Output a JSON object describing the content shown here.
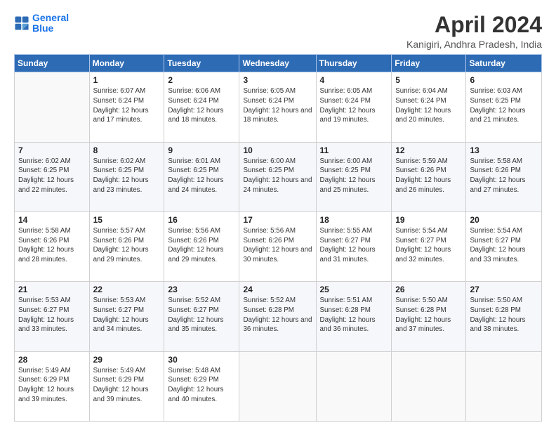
{
  "logo": {
    "line1": "General",
    "line2": "Blue"
  },
  "header": {
    "title": "April 2024",
    "location": "Kanigiri, Andhra Pradesh, India"
  },
  "weekdays": [
    "Sunday",
    "Monday",
    "Tuesday",
    "Wednesday",
    "Thursday",
    "Friday",
    "Saturday"
  ],
  "weeks": [
    [
      {
        "day": "",
        "sunrise": "",
        "sunset": "",
        "daylight": ""
      },
      {
        "day": "1",
        "sunrise": "Sunrise: 6:07 AM",
        "sunset": "Sunset: 6:24 PM",
        "daylight": "Daylight: 12 hours and 17 minutes."
      },
      {
        "day": "2",
        "sunrise": "Sunrise: 6:06 AM",
        "sunset": "Sunset: 6:24 PM",
        "daylight": "Daylight: 12 hours and 18 minutes."
      },
      {
        "day": "3",
        "sunrise": "Sunrise: 6:05 AM",
        "sunset": "Sunset: 6:24 PM",
        "daylight": "Daylight: 12 hours and 18 minutes."
      },
      {
        "day": "4",
        "sunrise": "Sunrise: 6:05 AM",
        "sunset": "Sunset: 6:24 PM",
        "daylight": "Daylight: 12 hours and 19 minutes."
      },
      {
        "day": "5",
        "sunrise": "Sunrise: 6:04 AM",
        "sunset": "Sunset: 6:24 PM",
        "daylight": "Daylight: 12 hours and 20 minutes."
      },
      {
        "day": "6",
        "sunrise": "Sunrise: 6:03 AM",
        "sunset": "Sunset: 6:25 PM",
        "daylight": "Daylight: 12 hours and 21 minutes."
      }
    ],
    [
      {
        "day": "7",
        "sunrise": "Sunrise: 6:02 AM",
        "sunset": "Sunset: 6:25 PM",
        "daylight": "Daylight: 12 hours and 22 minutes."
      },
      {
        "day": "8",
        "sunrise": "Sunrise: 6:02 AM",
        "sunset": "Sunset: 6:25 PM",
        "daylight": "Daylight: 12 hours and 23 minutes."
      },
      {
        "day": "9",
        "sunrise": "Sunrise: 6:01 AM",
        "sunset": "Sunset: 6:25 PM",
        "daylight": "Daylight: 12 hours and 24 minutes."
      },
      {
        "day": "10",
        "sunrise": "Sunrise: 6:00 AM",
        "sunset": "Sunset: 6:25 PM",
        "daylight": "Daylight: 12 hours and 24 minutes."
      },
      {
        "day": "11",
        "sunrise": "Sunrise: 6:00 AM",
        "sunset": "Sunset: 6:25 PM",
        "daylight": "Daylight: 12 hours and 25 minutes."
      },
      {
        "day": "12",
        "sunrise": "Sunrise: 5:59 AM",
        "sunset": "Sunset: 6:26 PM",
        "daylight": "Daylight: 12 hours and 26 minutes."
      },
      {
        "day": "13",
        "sunrise": "Sunrise: 5:58 AM",
        "sunset": "Sunset: 6:26 PM",
        "daylight": "Daylight: 12 hours and 27 minutes."
      }
    ],
    [
      {
        "day": "14",
        "sunrise": "Sunrise: 5:58 AM",
        "sunset": "Sunset: 6:26 PM",
        "daylight": "Daylight: 12 hours and 28 minutes."
      },
      {
        "day": "15",
        "sunrise": "Sunrise: 5:57 AM",
        "sunset": "Sunset: 6:26 PM",
        "daylight": "Daylight: 12 hours and 29 minutes."
      },
      {
        "day": "16",
        "sunrise": "Sunrise: 5:56 AM",
        "sunset": "Sunset: 6:26 PM",
        "daylight": "Daylight: 12 hours and 29 minutes."
      },
      {
        "day": "17",
        "sunrise": "Sunrise: 5:56 AM",
        "sunset": "Sunset: 6:26 PM",
        "daylight": "Daylight: 12 hours and 30 minutes."
      },
      {
        "day": "18",
        "sunrise": "Sunrise: 5:55 AM",
        "sunset": "Sunset: 6:27 PM",
        "daylight": "Daylight: 12 hours and 31 minutes."
      },
      {
        "day": "19",
        "sunrise": "Sunrise: 5:54 AM",
        "sunset": "Sunset: 6:27 PM",
        "daylight": "Daylight: 12 hours and 32 minutes."
      },
      {
        "day": "20",
        "sunrise": "Sunrise: 5:54 AM",
        "sunset": "Sunset: 6:27 PM",
        "daylight": "Daylight: 12 hours and 33 minutes."
      }
    ],
    [
      {
        "day": "21",
        "sunrise": "Sunrise: 5:53 AM",
        "sunset": "Sunset: 6:27 PM",
        "daylight": "Daylight: 12 hours and 33 minutes."
      },
      {
        "day": "22",
        "sunrise": "Sunrise: 5:53 AM",
        "sunset": "Sunset: 6:27 PM",
        "daylight": "Daylight: 12 hours and 34 minutes."
      },
      {
        "day": "23",
        "sunrise": "Sunrise: 5:52 AM",
        "sunset": "Sunset: 6:27 PM",
        "daylight": "Daylight: 12 hours and 35 minutes."
      },
      {
        "day": "24",
        "sunrise": "Sunrise: 5:52 AM",
        "sunset": "Sunset: 6:28 PM",
        "daylight": "Daylight: 12 hours and 36 minutes."
      },
      {
        "day": "25",
        "sunrise": "Sunrise: 5:51 AM",
        "sunset": "Sunset: 6:28 PM",
        "daylight": "Daylight: 12 hours and 36 minutes."
      },
      {
        "day": "26",
        "sunrise": "Sunrise: 5:50 AM",
        "sunset": "Sunset: 6:28 PM",
        "daylight": "Daylight: 12 hours and 37 minutes."
      },
      {
        "day": "27",
        "sunrise": "Sunrise: 5:50 AM",
        "sunset": "Sunset: 6:28 PM",
        "daylight": "Daylight: 12 hours and 38 minutes."
      }
    ],
    [
      {
        "day": "28",
        "sunrise": "Sunrise: 5:49 AM",
        "sunset": "Sunset: 6:29 PM",
        "daylight": "Daylight: 12 hours and 39 minutes."
      },
      {
        "day": "29",
        "sunrise": "Sunrise: 5:49 AM",
        "sunset": "Sunset: 6:29 PM",
        "daylight": "Daylight: 12 hours and 39 minutes."
      },
      {
        "day": "30",
        "sunrise": "Sunrise: 5:48 AM",
        "sunset": "Sunset: 6:29 PM",
        "daylight": "Daylight: 12 hours and 40 minutes."
      },
      {
        "day": "",
        "sunrise": "",
        "sunset": "",
        "daylight": ""
      },
      {
        "day": "",
        "sunrise": "",
        "sunset": "",
        "daylight": ""
      },
      {
        "day": "",
        "sunrise": "",
        "sunset": "",
        "daylight": ""
      },
      {
        "day": "",
        "sunrise": "",
        "sunset": "",
        "daylight": ""
      }
    ]
  ]
}
